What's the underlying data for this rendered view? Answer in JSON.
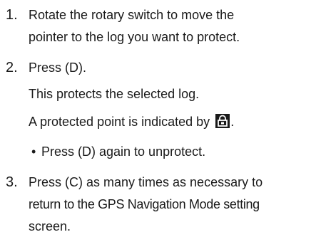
{
  "steps": [
    {
      "number": "1.",
      "lines": [
        "Rotate the rotary switch to move the",
        "pointer to the log you want to protect."
      ]
    },
    {
      "number": "2.",
      "lines": [
        "Press (D)."
      ],
      "notes": [
        "This protects the selected log.",
        "A protected point is indicated by"
      ],
      "icon": "padlock-icon",
      "note_suffix": ".",
      "bullet": "Press (D) again to unprotect."
    },
    {
      "number": "3.",
      "lines": [
        "Press (C) as many times as necessary to",
        "return to the GPS Navigation Mode setting",
        "screen."
      ]
    }
  ],
  "bullet_symbol": "•"
}
